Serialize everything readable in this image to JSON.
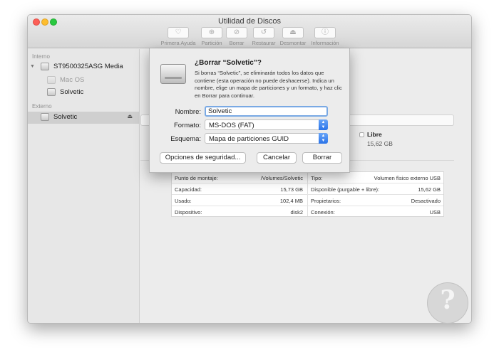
{
  "window": {
    "title": "Utilidad de Discos"
  },
  "toolbar": {
    "items": [
      {
        "label": "Primera Ayuda",
        "icon": "stethoscope-icon",
        "glyph": "♡"
      },
      {
        "label": "Partición",
        "icon": "partition-icon",
        "glyph": "⊕"
      },
      {
        "label": "Borrar",
        "icon": "erase-icon",
        "glyph": "⊘"
      },
      {
        "label": "Restaurar",
        "icon": "restore-icon",
        "glyph": "↺"
      },
      {
        "label": "Desmontar",
        "icon": "unmount-icon",
        "glyph": "⏏"
      },
      {
        "label": "Información",
        "icon": "info-icon",
        "glyph": "ⓘ"
      }
    ]
  },
  "sidebar": {
    "internal_header": "Interno",
    "external_header": "Externo",
    "internal_items": [
      {
        "label": "ST9500325ASG Media"
      },
      {
        "label": "Mac OS"
      },
      {
        "label": "Solvetic"
      }
    ],
    "external_items": [
      {
        "label": "Solvetic"
      }
    ]
  },
  "main": {
    "libre_label": "Libre",
    "libre_value": "15,62 GB",
    "info_left": [
      {
        "key": "Punto de montaje:",
        "value": "/Volumes/Solvetic"
      },
      {
        "key": "Capacidad:",
        "value": "15,73 GB"
      },
      {
        "key": "Usado:",
        "value": "102,4 MB"
      },
      {
        "key": "Dispositivo:",
        "value": "disk2"
      }
    ],
    "info_right": [
      {
        "key": "Tipo:",
        "value": "Volumen físico externo USB"
      },
      {
        "key": "Disponible (purgable + libre):",
        "value": "15,62 GB"
      },
      {
        "key": "Propietarios:",
        "value": "Desactivado"
      },
      {
        "key": "Conexión:",
        "value": "USB"
      }
    ]
  },
  "dialog": {
    "title": "¿Borrar “Solvetic”?",
    "message": "Si borras “Solvetic”, se eliminarán todos los datos que contiene (esta operación no puede deshacerse). Indica un nombre, elige un mapa de particiones y un formato, y haz clic en Borrar para continuar.",
    "name_label": "Nombre:",
    "name_value": "Solvetic",
    "format_label": "Formato:",
    "format_value": "MS-DOS (FAT)",
    "scheme_label": "Esquema:",
    "scheme_value": "Mapa de particiones GUID",
    "security_button": "Opciones de seguridad...",
    "cancel_button": "Cancelar",
    "erase_button": "Borrar"
  },
  "colors": {
    "focus_ring": "#79a9e4",
    "popup_arrow": "#2a73e8",
    "close": "#fc5f57",
    "minimize": "#fdbd2e",
    "maximize": "#29c940"
  }
}
